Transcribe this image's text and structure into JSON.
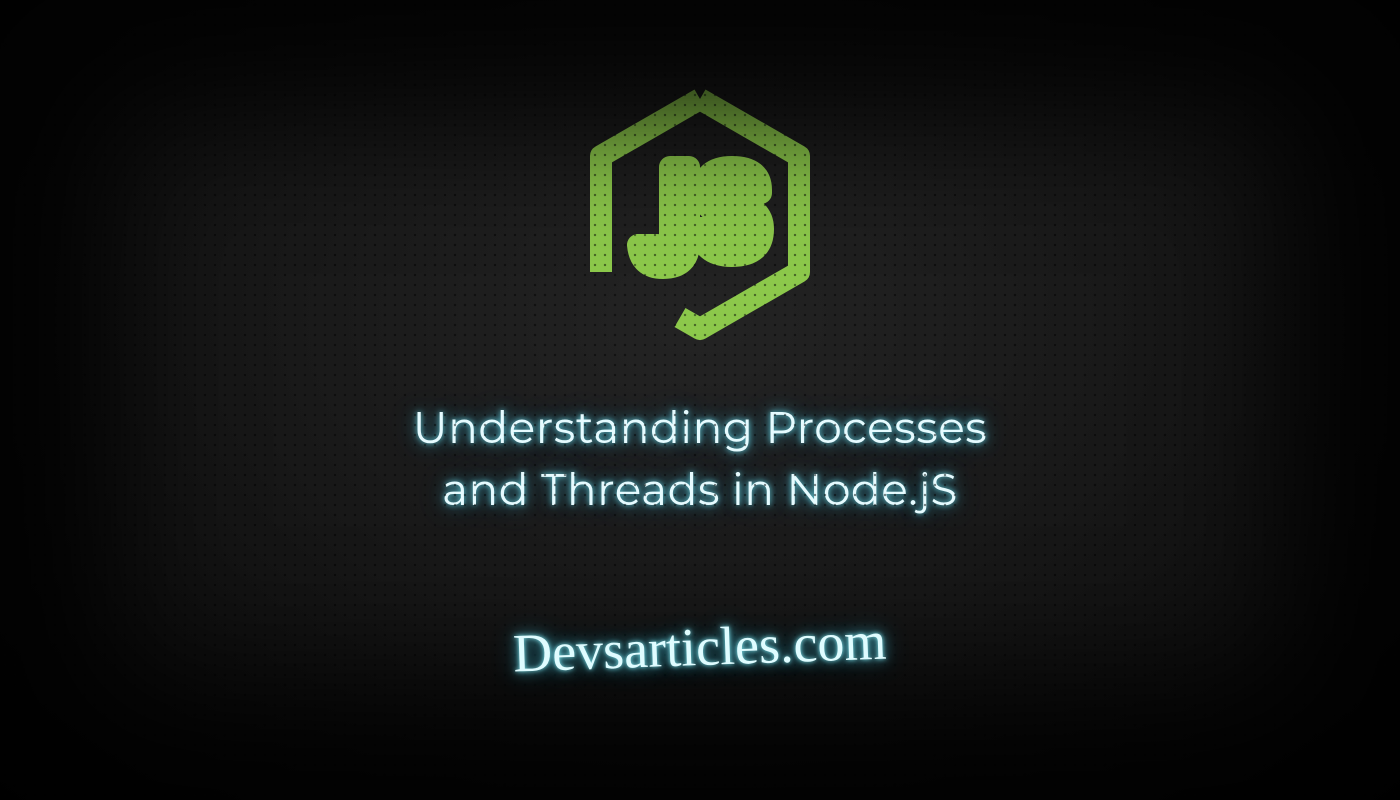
{
  "logo": {
    "name": "nodejs-logo",
    "text": "JS",
    "color": "#8cc84b"
  },
  "title": {
    "line1": "Understanding Processes",
    "line2": "and Threads in Node.jS"
  },
  "site": "Devsarticles.com",
  "glow_color": "#7df0ff"
}
